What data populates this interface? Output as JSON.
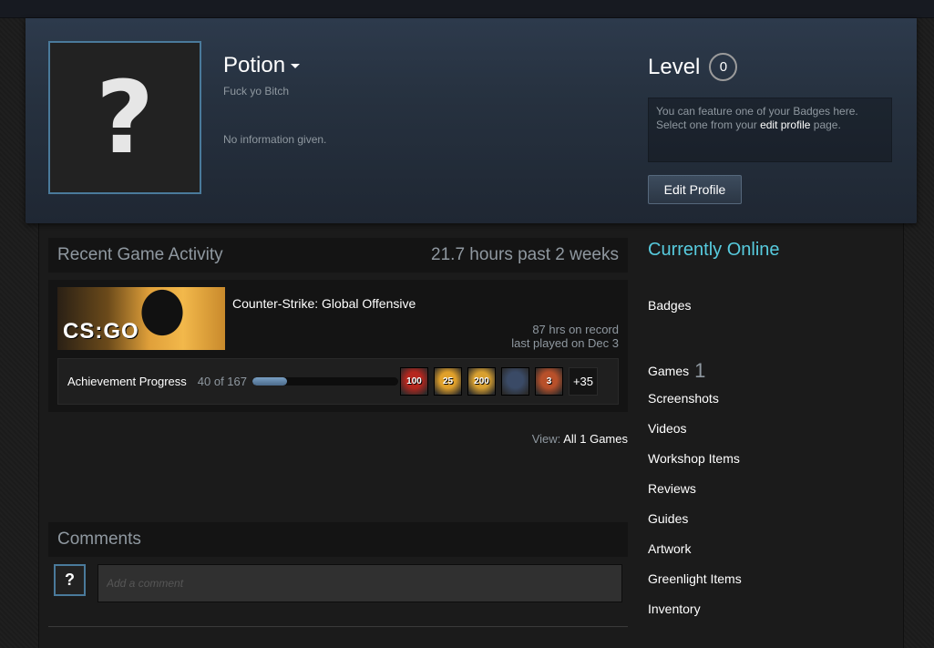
{
  "header": {
    "persona_name": "Potion",
    "real_name": "Fuck yo Bitch",
    "summary": "No information given.",
    "avatar_glyph": "?",
    "level_label": "Level",
    "level_value": "0",
    "badge_text_1": "You can feature one of your Badges here. Select one from your",
    "badge_link": "edit profile",
    "badge_text_2": "page.",
    "edit_button": "Edit Profile"
  },
  "recent_activity": {
    "title": "Recent Game Activity",
    "hours_past": "21.7 hours past 2 weeks",
    "game": {
      "name": "Counter-Strike: Global Offensive",
      "capsule_logo": "CS:GO",
      "hours_on_record": "87 hrs on record",
      "last_played": "last played on Dec 3"
    },
    "achievements": {
      "label": "Achievement Progress",
      "count": "40 of 167",
      "progress_fraction": 0.24,
      "icons": [
        {
          "name": "medal-icon",
          "text": "100",
          "color": "#b5261e"
        },
        {
          "name": "pistol-icon",
          "text": "25",
          "color": "#e0a02a"
        },
        {
          "name": "stars-icon",
          "text": "200",
          "color": "#d8a030"
        },
        {
          "name": "squad-icon",
          "text": "",
          "color": "#3a4a66"
        },
        {
          "name": "target-icon",
          "text": "3",
          "color": "#b8502a"
        }
      ],
      "more": "+35"
    },
    "view_prefix": "View:",
    "view_link": "All 1 Games"
  },
  "comments": {
    "title": "Comments",
    "avatar_glyph": "?",
    "placeholder": "Add a comment"
  },
  "sidebar": {
    "status": "Currently Online",
    "links": [
      {
        "label": "Badges",
        "count": ""
      },
      {
        "label": "Games",
        "count": "1"
      },
      {
        "label": "Screenshots",
        "count": ""
      },
      {
        "label": "Videos",
        "count": ""
      },
      {
        "label": "Workshop Items",
        "count": ""
      },
      {
        "label": "Reviews",
        "count": ""
      },
      {
        "label": "Guides",
        "count": ""
      },
      {
        "label": "Artwork",
        "count": ""
      },
      {
        "label": "Greenlight Items",
        "count": ""
      },
      {
        "label": "Inventory",
        "count": ""
      }
    ]
  }
}
